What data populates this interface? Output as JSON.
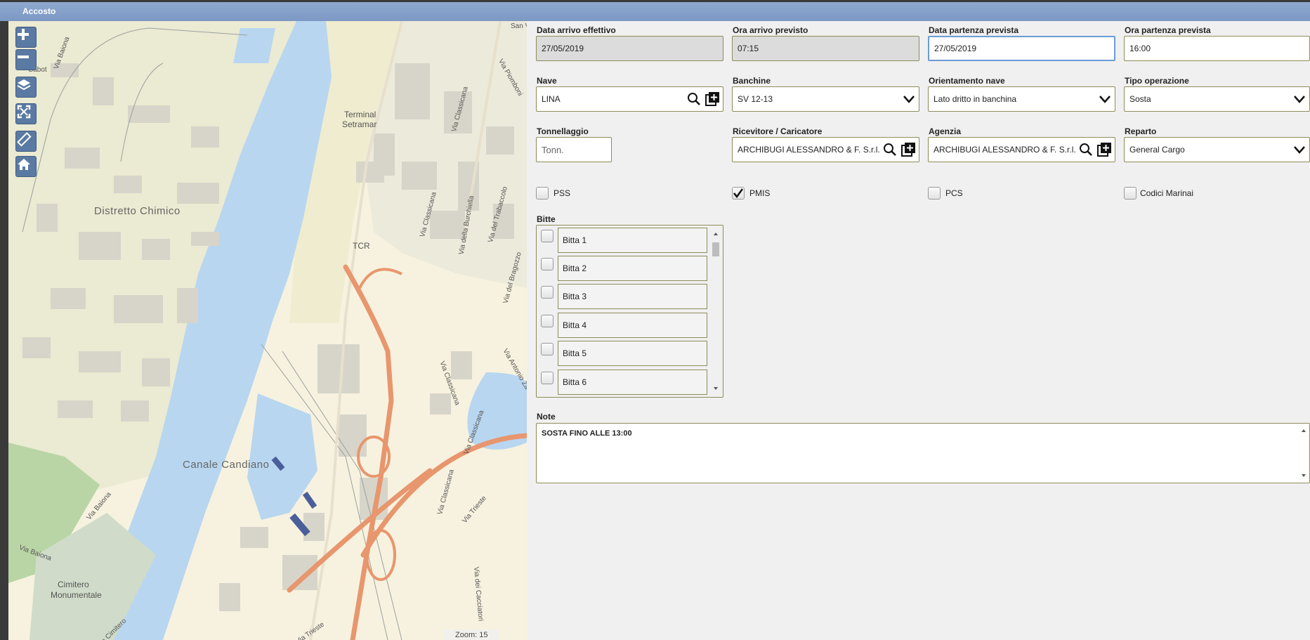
{
  "window": {
    "title": "Accosto"
  },
  "map": {
    "labels": {
      "distretto": "Distretto Chimico",
      "canale": "Canale Candiano",
      "terminal1": "Terminal",
      "terminal2": "Setramar",
      "tcr": "TCR",
      "cimitero1": "Cimitero",
      "cimitero2": "Monumentale",
      "cabot": "Cabot",
      "via_baiona_top": "Via Baiona",
      "via_baiona_left": "Via Baiona",
      "via_baiona_bottom": "Via Baiona",
      "via_classicana_1": "Via Classicana",
      "via_classicana_2": "Via Classicana",
      "via_classicana_3": "Via Classicana",
      "via_classicana_4": "Via Classicana",
      "via_classicana_5": "Via Classicana",
      "via_piombone": "Via Piomboni",
      "via_buchella": "Via della Burchiella",
      "via_trabaccolo": "Via del Trabaccolo",
      "via_bragozzo": "Via del Bragozzo",
      "via_antonio": "Via Antonio Za",
      "via_trieste_1": "Via Trieste",
      "via_trieste_2": "Via Trieste",
      "via_cimitero": "Via Cimitero",
      "via_cacciatori": "Via dei Cacciatori",
      "san_v": "San V"
    },
    "zoom_label": "Zoom: 15",
    "controls": [
      "zoom-in-icon",
      "zoom-out-icon",
      "layers-icon",
      "fullscreen-icon",
      "measure-icon",
      "home-icon"
    ]
  },
  "form": {
    "data_arrivo": {
      "label": "Data arrivo effettivo",
      "value": "27/05/2019"
    },
    "ora_arrivo": {
      "label": "Ora arrivo previsto",
      "value": "07:15"
    },
    "data_partenza": {
      "label": "Data partenza prevista",
      "value": "27/05/2019"
    },
    "ora_partenza": {
      "label": "Ora partenza prevista",
      "value": "16:00"
    },
    "nave": {
      "label": "Nave",
      "value": "LINA"
    },
    "banchine": {
      "label": "Banchine",
      "value": "SV 12-13"
    },
    "orientamento": {
      "label": "Orientamento nave",
      "value": "Lato dritto in banchina"
    },
    "tipo_operazione": {
      "label": "Tipo operazione",
      "value": "Sosta"
    },
    "tonnellaggio": {
      "label": "Tonnellaggio",
      "placeholder": "Tonn."
    },
    "ricevitore": {
      "label": "Ricevitore / Caricatore",
      "value": "ARCHIBUGI ALESSANDRO & F. S.r.l."
    },
    "agenzia": {
      "label": "Agenzia",
      "value": "ARCHIBUGI ALESSANDRO & F. S.r.l."
    },
    "reparto": {
      "label": "Reparto",
      "value": "General Cargo"
    },
    "checks": {
      "pss": {
        "label": "PSS",
        "checked": false
      },
      "pmis": {
        "label": "PMIS",
        "checked": true
      },
      "pcs": {
        "label": "PCS",
        "checked": false
      },
      "codici": {
        "label": "Codici Marinai",
        "checked": false
      }
    },
    "bitte": {
      "label": "Bitte",
      "items": [
        "Bitta 1",
        "Bitta 2",
        "Bitta 3",
        "Bitta 4",
        "Bitta 5",
        "Bitta 6"
      ]
    },
    "note": {
      "label": "Note",
      "value": "SOSTA FINO ALLE 13:00"
    }
  }
}
